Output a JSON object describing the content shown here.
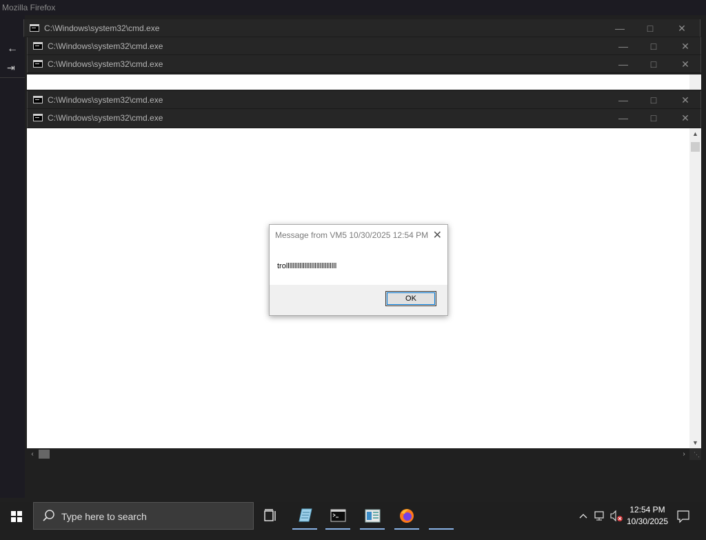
{
  "firefox": {
    "window_title": "Mozilla Firefox"
  },
  "cmd_windows": [
    {
      "title": "C:\\Windows\\system32\\cmd.exe"
    },
    {
      "title": "C:\\Windows\\system32\\cmd.exe"
    },
    {
      "title": "C:\\Windows\\system32\\cmd.exe"
    },
    {
      "title": "C:\\Windows\\system32\\cmd.exe"
    },
    {
      "title": "C:\\Windows\\system32\\cmd.exe"
    }
  ],
  "window_controls": {
    "minimize": "—",
    "maximize": "□",
    "close": "✕"
  },
  "message_box": {
    "title": "Message from VM5 10/30/2025 12:54 PM",
    "message": "trollllllllllllllllllllllllllllll",
    "ok_label": "OK"
  },
  "taskbar": {
    "search_placeholder": "Type here to search",
    "apps": [
      "task-view-icon",
      "notepad-icon",
      "cmd-icon",
      "registry-editor-icon",
      "firefox-icon"
    ],
    "time": "12:54 PM",
    "date": "10/30/2025"
  }
}
